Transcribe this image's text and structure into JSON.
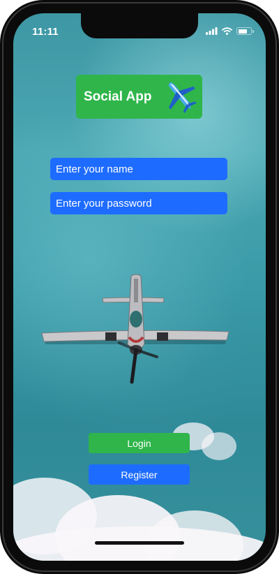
{
  "status_bar": {
    "time": "11:11",
    "icons": [
      "signal-icon",
      "wifi-icon",
      "battery-icon"
    ],
    "battery_level": 0.8
  },
  "logo": {
    "text": "Social App",
    "icon": "airplane-icon",
    "background": "#2fb54a"
  },
  "form": {
    "name_placeholder": "Enter your name",
    "name_value": "",
    "password_placeholder": "Enter your password",
    "password_value": "",
    "input_background": "#1e6cff"
  },
  "buttons": {
    "login_label": "Login",
    "login_color": "#2fb54a",
    "register_label": "Register",
    "register_color": "#1e6cff"
  },
  "background": {
    "image": "airplane-over-sky-photo"
  }
}
